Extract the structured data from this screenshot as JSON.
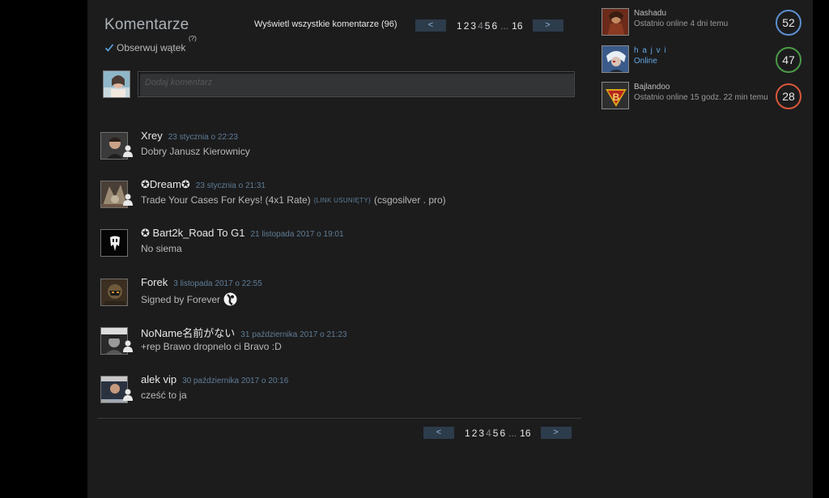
{
  "comments_section": {
    "title": "Komentarze",
    "follow_label": "Obserwuj wątek",
    "help_label": "(?)",
    "view_all_label": "Wyświetl wszystkie komentarze (96)",
    "add_placeholder": "Dodaj komentarz"
  },
  "pagination": {
    "prev_label": "<",
    "next_label": ">",
    "pages": [
      "1",
      "2",
      "3",
      "4",
      "5",
      "6"
    ],
    "current_page": "4",
    "ellipsis": "...",
    "last_page": "16"
  },
  "comments": [
    {
      "author": "Xrey",
      "date": "23 stycznia o 22:23",
      "text": "Dobry Janusz Kierownicy"
    },
    {
      "author": "✪Dream✪",
      "date": "23 stycznia o 21:31",
      "text": "Trade Your Cases For Keys! (4x1 Rate)",
      "removed_link": "{LINK USUNIĘTY}",
      "text_after": "(csgosilver . pro)"
    },
    {
      "author": "✪ Bart2k_Road To G1",
      "date": "21 listopada 2017 o 19:01",
      "text": "No siema"
    },
    {
      "author": "Forek",
      "date": "3 listopada 2017 o 22:55",
      "text": "Signed by Forever"
    },
    {
      "author": "NoName名前がない",
      "date": "31 października 2017 o 21:23",
      "text": "+rep Brawo dropnelo ci Bravo :D"
    },
    {
      "author": "alek vip",
      "date": "30 października 2017 o 20:16",
      "text": "cześć to ja"
    }
  ],
  "friends": [
    {
      "name": "Nashadu",
      "status": "Ostatnio online 4 dni temu",
      "level": "52",
      "level_color": "#5d8fd0"
    },
    {
      "name": "h a j v i",
      "status": "Online",
      "level": "47",
      "level_color": "#4c9a47"
    },
    {
      "name": "Bajlandoo",
      "status": "Ostatnio online 15 godz. 22 min temu",
      "level": "28",
      "level_color": "#d8583a"
    }
  ],
  "colors": {
    "background": "#1c1c1d",
    "link_date": "#5f7d95",
    "online": "#62a7e3",
    "pager_button": "#2d3c4b"
  }
}
